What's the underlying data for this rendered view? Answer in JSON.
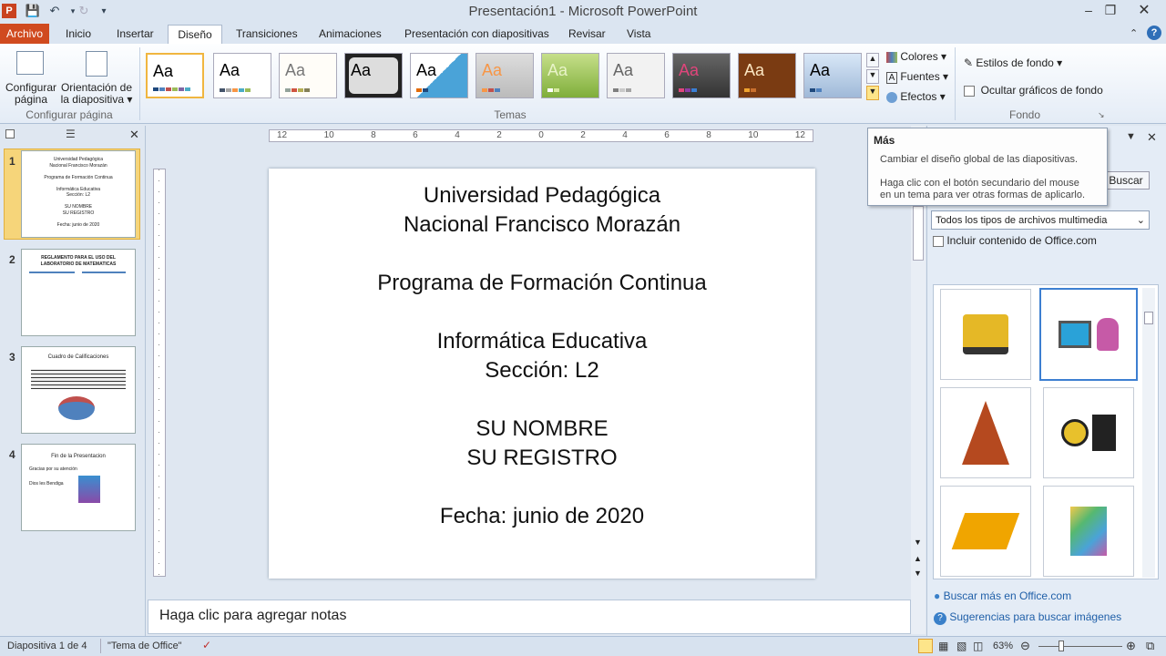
{
  "window": {
    "title": "Presentación1 - Microsoft PowerPoint"
  },
  "tabs": [
    "Archivo",
    "Inicio",
    "Insertar",
    "Diseño",
    "Transiciones",
    "Animaciones",
    "Presentación con diapositivas",
    "Revisar",
    "Vista"
  ],
  "ribbon": {
    "configurar_pagina": {
      "label1": "Configurar",
      "label1b": "página",
      "label2": "Orientación de",
      "label2b": "la diapositiva",
      "group": "Configurar página"
    },
    "temas_group": "Temas",
    "colores": "Colores",
    "fuentes": "Fuentes",
    "efectos": "Efectos",
    "estilos_fondo": "Estilos de fondo",
    "ocultar_graficos": "Ocultar gráficos de fondo",
    "fondo_group": "Fondo",
    "theme_sample": "Aa"
  },
  "thumbnails": [
    {
      "num": "1",
      "lines": [
        "Universidad Pedagógica",
        "Nacional Francisco Morazán",
        "",
        "Programa de Formación Continua",
        "",
        "Informática Educativa",
        "Sección: L2",
        "",
        "SU NOMBRE",
        "SU REGISTRO",
        "",
        "Fecha: junio de 2020"
      ]
    },
    {
      "num": "2",
      "lines": [
        "REGLAMENTO PARA EL USO DEL",
        "LABORATORIO DE MATEMATICAS"
      ]
    },
    {
      "num": "3",
      "lines": [
        "Cuadro de Calificaciones"
      ]
    },
    {
      "num": "4",
      "lines": [
        "Fin de la Presentacion",
        "Gracias por su atención",
        "Dios les Bendiga"
      ]
    }
  ],
  "ruler": {
    "h_labels": [
      "12",
      "10",
      "8",
      "6",
      "4",
      "2",
      "0",
      "2",
      "4",
      "6",
      "8",
      "10",
      "12"
    ]
  },
  "slide": {
    "lines": [
      "Universidad Pedagógica",
      "Nacional Francisco Morazán",
      "",
      "Programa de Formación Continua",
      "",
      "Informática Educativa",
      "Sección: L2",
      "",
      "SU NOMBRE",
      "SU REGISTRO",
      "",
      "Fecha:  junio de 2020"
    ]
  },
  "notes": {
    "placeholder": "Haga clic para agregar notas"
  },
  "tooltip": {
    "title": "Más",
    "line1": "Cambiar el diseño global de las diapositivas.",
    "line2": "Haga clic con el botón secundario del mouse",
    "line3": "en un tema para ver otras formas de aplicarlo."
  },
  "clipart": {
    "buscar": "Buscar",
    "media_type": "Todos los tipos de archivos multimedia",
    "include_office": "Incluir contenido de Office.com",
    "link1": "Buscar más en Office.com",
    "link2": "Sugerencias para buscar imágenes",
    "items": [
      "forklift-clip",
      "computer-user-clip",
      "pagoda-clip",
      "lightbulb-thinker-clip",
      "crane-clip",
      "colorful-papers-clip"
    ]
  },
  "status": {
    "slide_info": "Diapositiva 1 de 4",
    "theme": "\"Tema de Office\"",
    "zoom": "63%"
  },
  "colors": {
    "archivo": "#d04a1f",
    "selected_thumb": "#f6d57a"
  }
}
